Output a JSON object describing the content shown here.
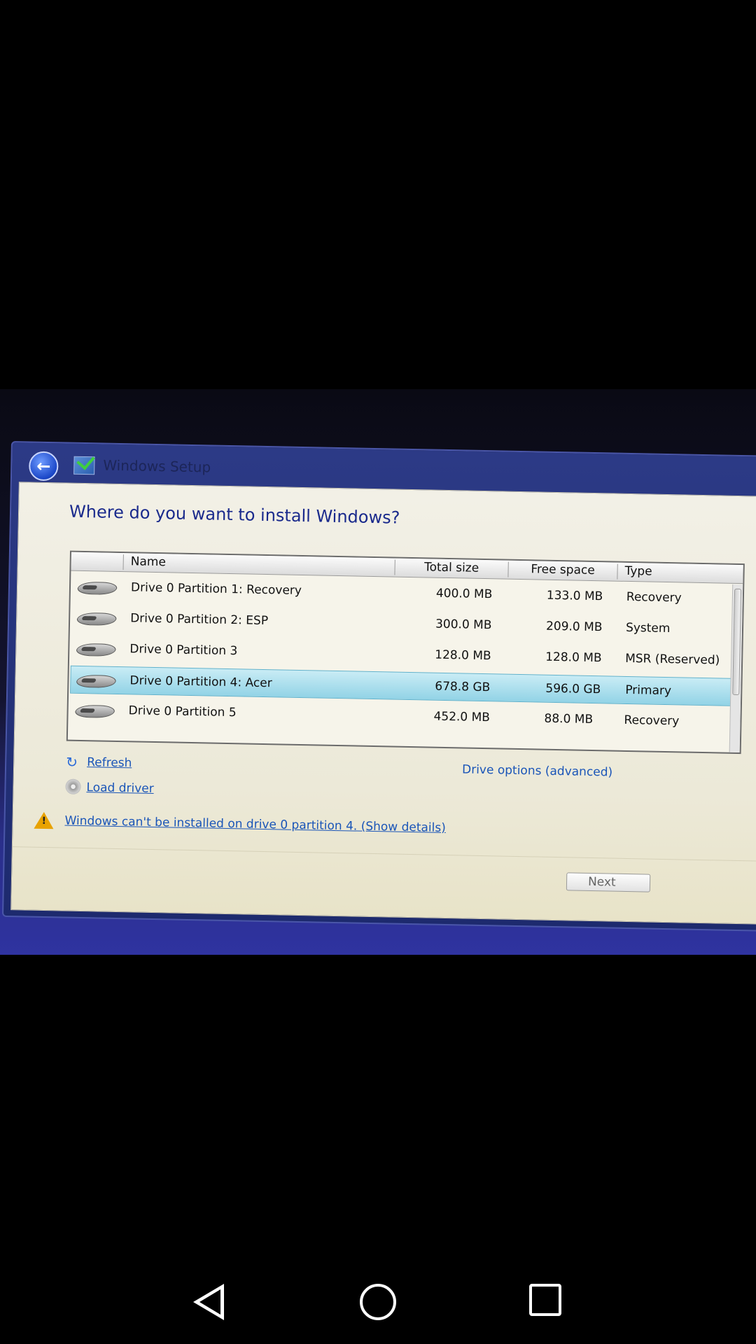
{
  "window": {
    "title": "Windows Setup",
    "heading": "Where do you want to install Windows?"
  },
  "table": {
    "columns": [
      "Name",
      "Total size",
      "Free space",
      "Type"
    ],
    "rows": [
      {
        "name": "Drive 0 Partition 1: Recovery",
        "total": "400.0 MB",
        "free": "133.0 MB",
        "type": "Recovery",
        "selected": false
      },
      {
        "name": "Drive 0 Partition 2: ESP",
        "total": "300.0 MB",
        "free": "209.0 MB",
        "type": "System",
        "selected": false
      },
      {
        "name": "Drive 0 Partition 3",
        "total": "128.0 MB",
        "free": "128.0 MB",
        "type": "MSR (Reserved)",
        "selected": false
      },
      {
        "name": "Drive 0 Partition 4: Acer",
        "total": "678.8 GB",
        "free": "596.0 GB",
        "type": "Primary",
        "selected": true
      },
      {
        "name": "Drive 0 Partition 5",
        "total": "452.0 MB",
        "free": "88.0 MB",
        "type": "Recovery",
        "selected": false
      }
    ]
  },
  "actions": {
    "refresh": "Refresh",
    "load_driver": "Load driver",
    "drive_options": "Drive options (advanced)"
  },
  "warning": {
    "text": "Windows can't be installed on drive 0 partition 4.  (Show details)"
  },
  "buttons": {
    "next": "Next"
  },
  "icons": {
    "back": "back-arrow-icon",
    "setup": "windows-setup-icon",
    "drive": "hard-drive-icon",
    "refresh": "refresh-icon",
    "load_driver": "disc-icon",
    "warning": "warning-icon"
  }
}
